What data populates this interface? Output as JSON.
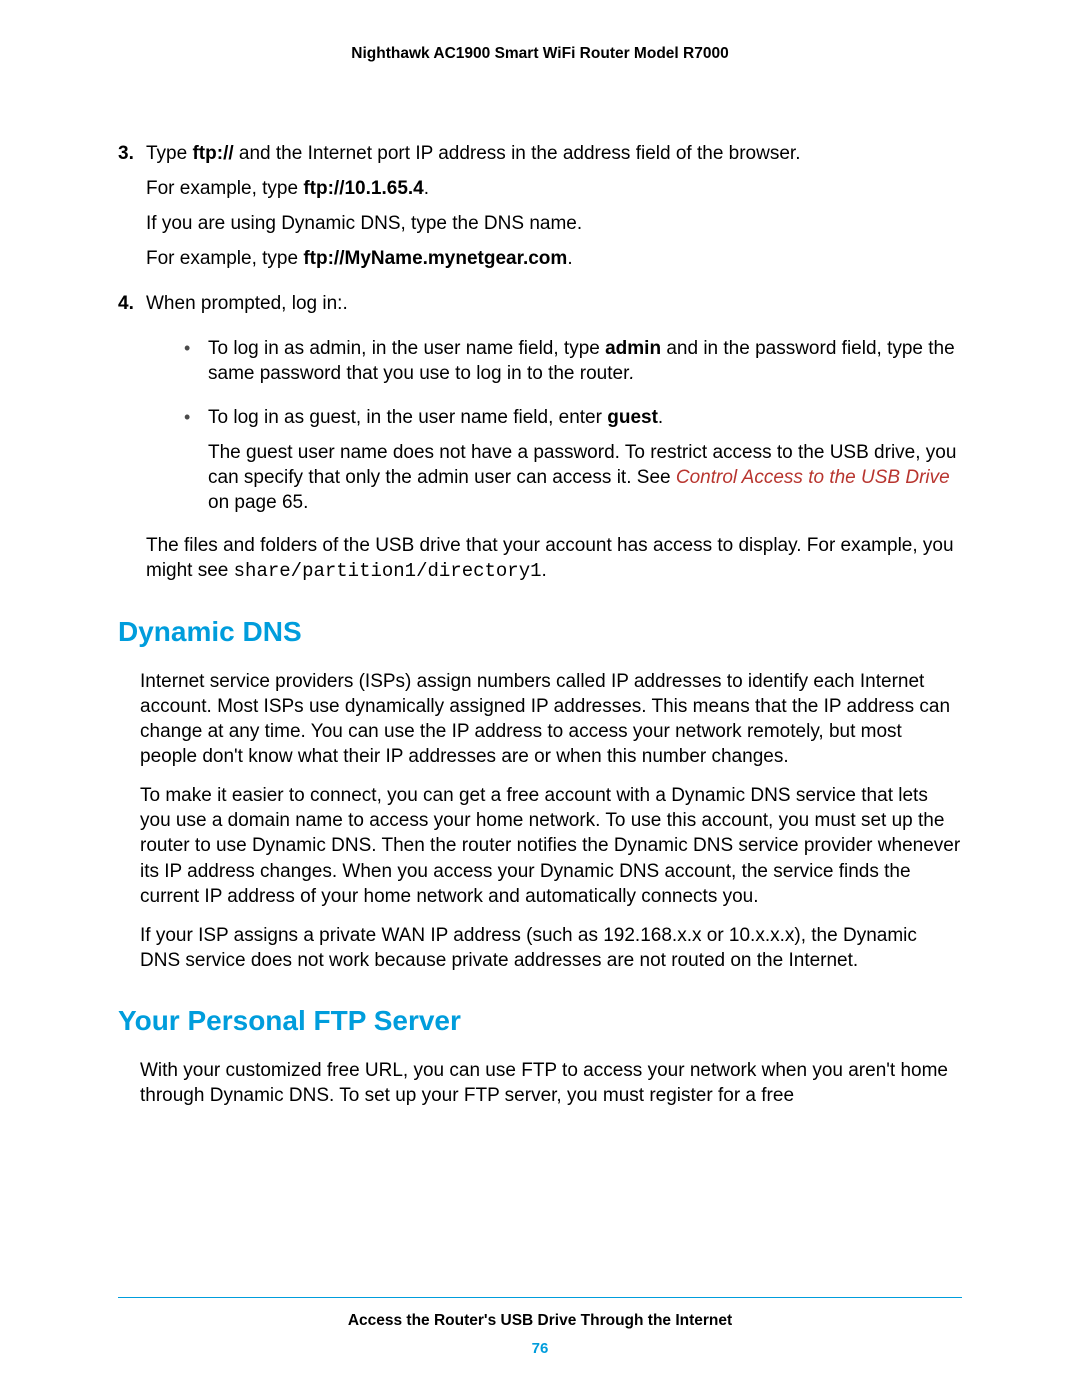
{
  "header": {
    "title": "Nighthawk AC1900 Smart WiFi Router Model R7000"
  },
  "step3": {
    "num": "3.",
    "line1_a": "Type ",
    "line1_b": "ftp://",
    "line1_c": " and the Internet port IP address in the address field of the browser.",
    "line2_a": "For example, type ",
    "line2_b": "ftp://10.1.65.4",
    "line2_c": ".",
    "line3": "If you are using Dynamic DNS, type the DNS name.",
    "line4_a": "For example, type ",
    "line4_b": "ftp://MyName.mynetgear.com",
    "line4_c": "."
  },
  "step4": {
    "num": "4.",
    "line1": "When prompted, log in:.",
    "bullet1_a": "To log in as admin, in the user name field, type ",
    "bullet1_b": "admin",
    "bullet1_c": " and in the password field, type the same password that you use to log in to the router",
    "bullet1_d": ".",
    "bullet2_a": "To log in as guest, in the user name field, enter ",
    "bullet2_b": "guest",
    "bullet2_c": ".",
    "bullet2_p2_a": "The guest user name does not have a password. To restrict access to the USB drive, you can specify that only the admin user can access it. See ",
    "bullet2_p2_link": "Control Access to the USB Drive",
    "bullet2_p2_b": " on page 65.",
    "closing_a": "The files and folders of the USB drive that your account has access to display. For example, you might see ",
    "closing_code": "share/partition1/directory1",
    "closing_b": "."
  },
  "section1": {
    "title": "Dynamic DNS",
    "p1": "Internet service providers (ISPs) assign numbers called IP addresses to identify each Internet account. Most ISPs use dynamically assigned IP addresses. This means that the IP address can change at any time. You can use the IP address to access your network remotely, but most people don't know what their IP addresses are or when this number changes.",
    "p2": "To make it easier to connect, you can get a free account with a Dynamic DNS service that lets you use a domain name to access your home network. To use this account, you must set up the router to use Dynamic DNS. Then the router notifies the Dynamic DNS service provider whenever its IP address changes. When you access your Dynamic DNS account, the service finds the current IP address of your home network and automatically connects you.",
    "p3": "If your ISP assigns a private WAN IP address (such as 192.168.x.x or 10.x.x.x), the Dynamic DNS service does not work because private addresses are not routed on the Internet."
  },
  "section2": {
    "title": "Your Personal FTP Server",
    "p1": "With your customized free URL, you can use FTP to access your network when you aren't home through Dynamic DNS. To set up your FTP server, you must register for a free"
  },
  "footer": {
    "title": "Access the Router's USB Drive Through the Internet",
    "page": "76"
  }
}
